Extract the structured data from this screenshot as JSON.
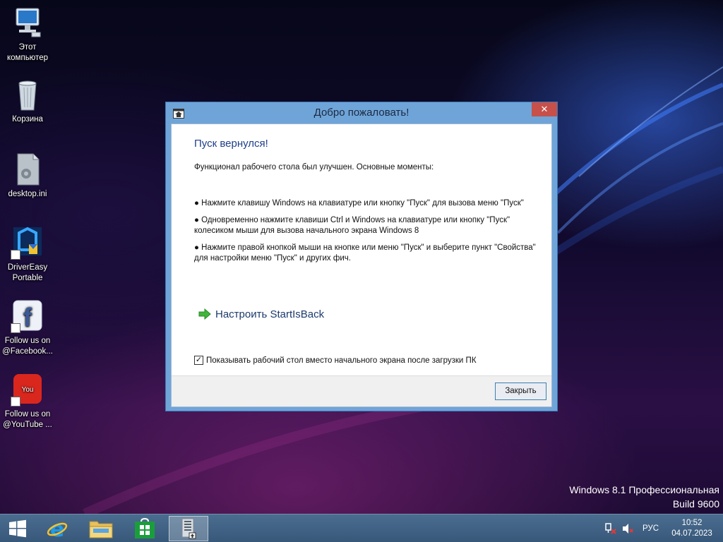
{
  "desktop": {
    "icons": [
      {
        "label": "Этот компьютер",
        "icon": "computer-icon"
      },
      {
        "label": "Корзина",
        "icon": "recycle-bin-icon"
      },
      {
        "label": "desktop.ini",
        "icon": "settings-file-icon"
      },
      {
        "label": "DriverEasy Portable",
        "icon": "drivereasy-icon"
      },
      {
        "label": "Follow us on @Facebook...",
        "icon": "facebook-icon"
      },
      {
        "label": "Follow us on @YouTube ...",
        "icon": "youtube-icon"
      }
    ],
    "watermark_line1": "Windows 8.1 Профессиональная",
    "watermark_line2": "Build 9600"
  },
  "dialog": {
    "title": "Добро пожаловать!",
    "close_glyph": "✕",
    "heading": "Пуск вернулся!",
    "intro": "Функционал рабочего стола был улучшен. Основные моменты:",
    "bullets": [
      "● Нажмите клавишу Windows на клавиатуре или кнопку \"Пуск\" для вызова меню \"Пуск\"",
      "● Одновременно нажмите клавиши Ctrl и Windows на клавиатуре или кнопку \"Пуск\" колесиком мыши для вызова начального экрана Windows 8",
      "● Нажмите правой кнопкой мыши на кнопке или меню \"Пуск\" и выберите пункт \"Свойства\" для настройки меню \"Пуск\" и других фич."
    ],
    "link_label": "Настроить StartIsBack",
    "checkbox_label": "Показывать рабочий стол вместо начального экрана после загрузки ПК",
    "checkbox_checked": true,
    "checkbox_glyph": "✓",
    "close_button": "Закрыть"
  },
  "taskbar": {
    "items": [
      "start-icon",
      "internet-explorer-icon",
      "file-explorer-icon",
      "store-icon",
      "startisback-app-icon"
    ],
    "language": "РУС",
    "time": "10:52",
    "date": "04.07.2023"
  },
  "colors": {
    "taskbar": "#3f6285",
    "dialog_frame": "#6fa4d8",
    "close_button": "#c7504a",
    "heading": "#1e3f8a"
  }
}
